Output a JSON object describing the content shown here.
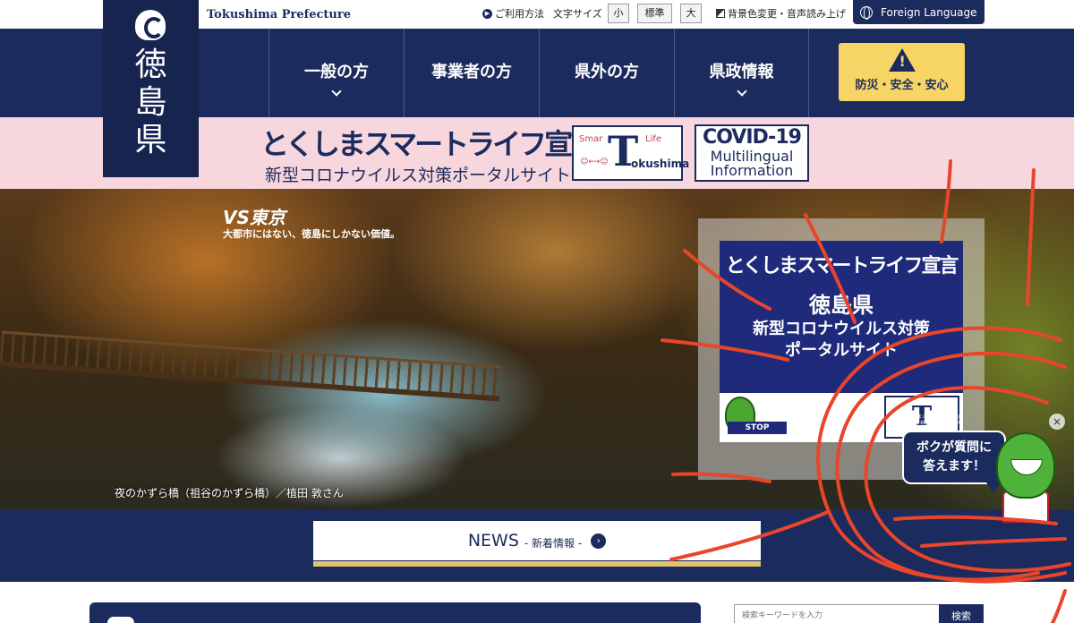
{
  "topbar": {
    "brand_en": "Tokushima Prefecture",
    "usage": "ご利用方法",
    "font_size_label": "文字サイズ",
    "font_small": "小",
    "font_standard": "標準",
    "font_large": "大",
    "accessibility": "背景色変更・音声読み上げ",
    "foreign_language": "Foreign Language"
  },
  "logo": {
    "chars": [
      "徳",
      "島",
      "県"
    ]
  },
  "nav": {
    "items": [
      {
        "label": "一般の方"
      },
      {
        "label": "事業者の方"
      },
      {
        "label": "県外の方"
      },
      {
        "label": "県政情報"
      }
    ],
    "disaster_label": "防災・安全・安心"
  },
  "banner": {
    "title": "とくしまスマートライフ宣言",
    "subtitle": "新型コロナウイルス対策ポータルサイト",
    "smart_logo": {
      "a": "Smar",
      "b": "Life",
      "t": "T",
      "c": "okushima",
      "d": "☺⟷☺"
    },
    "covid": {
      "line1": "COVID-19",
      "line2": "Multilingual",
      "line3": "Information"
    }
  },
  "hero": {
    "vs_title": "VS東京",
    "vs_sub": "大都市にはない、徳島にしかない価値。",
    "caption": "夜のかずら橋（祖谷のかずら橋）／植田 敦さん",
    "popup": {
      "line1": "とくしまスマートライフ宣言",
      "line2": "徳島県",
      "line3": "新型コロナウイルス対策",
      "line4": "ポータルサイト",
      "mini_logo": "T"
    },
    "stop": "STOP",
    "stop_meta": "とくしまスマートライフ宣言 徳島県 新型コロナウイルス対策",
    "close": "×"
  },
  "chat": {
    "line1": "ボクが質問に",
    "line2": "答えます！"
  },
  "news": {
    "main": "NEWS",
    "sub": "- 新着情報 -",
    "arrow": "›"
  },
  "search": {
    "placeholder": "検索キーワードを入力",
    "button": "検索"
  },
  "colors": {
    "navy": "#1c2b5e",
    "pink": "#f7d6dd",
    "yellow": "#f6d565",
    "gold": "#e2c470",
    "scribble": "#e8452a"
  }
}
